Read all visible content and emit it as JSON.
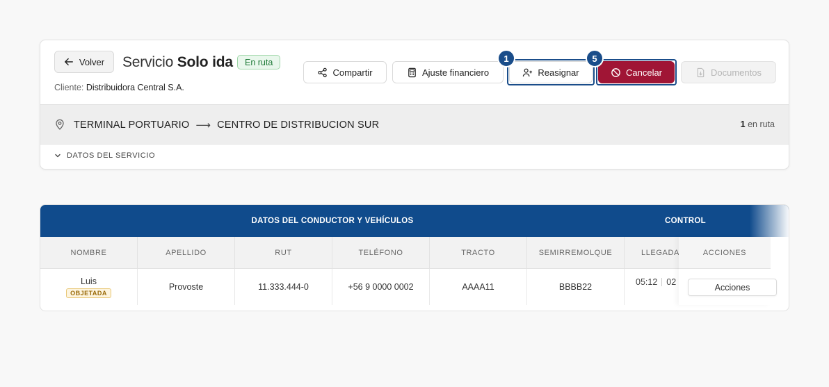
{
  "header": {
    "back_label": "Volver",
    "title_prefix": "Servicio",
    "title_main": "Solo ida",
    "status_badge": "En ruta",
    "client_label": "Cliente:",
    "client_name": "Distribuidora Central S.A."
  },
  "actions": {
    "share": "Compartir",
    "financial": "Ajuste financiero",
    "reassign": "Reasignar",
    "cancel": "Cancelar",
    "documents": "Documentos"
  },
  "markers": {
    "reassign": "1",
    "cancel": "5"
  },
  "route": {
    "origin": "TERMINAL PORTUARIO",
    "arrow": "⟶",
    "destination": "CENTRO DE DISTRIBUCION SUR",
    "count": "1",
    "count_label": "en ruta"
  },
  "details_toggle": "DATOS DEL SERVICIO",
  "table": {
    "group_driver": "DATOS DEL CONDUCTOR Y VEHÍCULOS",
    "group_control": "CONTROL",
    "columns": [
      "NOMBRE",
      "APELLIDO",
      "RUT",
      "TELÉFONO",
      "TRACTO",
      "SEMIRREMOLQUE",
      "LLEGADA",
      "ACCIONES"
    ],
    "row": {
      "nombre": "Luis",
      "flag": "OBJETADA",
      "apellido": "Provoste",
      "rut": "11.333.444-0",
      "telefono": "+56 9 0000 0002",
      "tracto": "AAAA11",
      "semirremolque": "BBBB22",
      "llegada_1": "05:12",
      "llegada_2": "02",
      "acciones": "Acciones"
    }
  },
  "colors": {
    "primary_blue": "#104b8c",
    "danger": "#a01535",
    "success_bg": "#e9f7ec"
  }
}
